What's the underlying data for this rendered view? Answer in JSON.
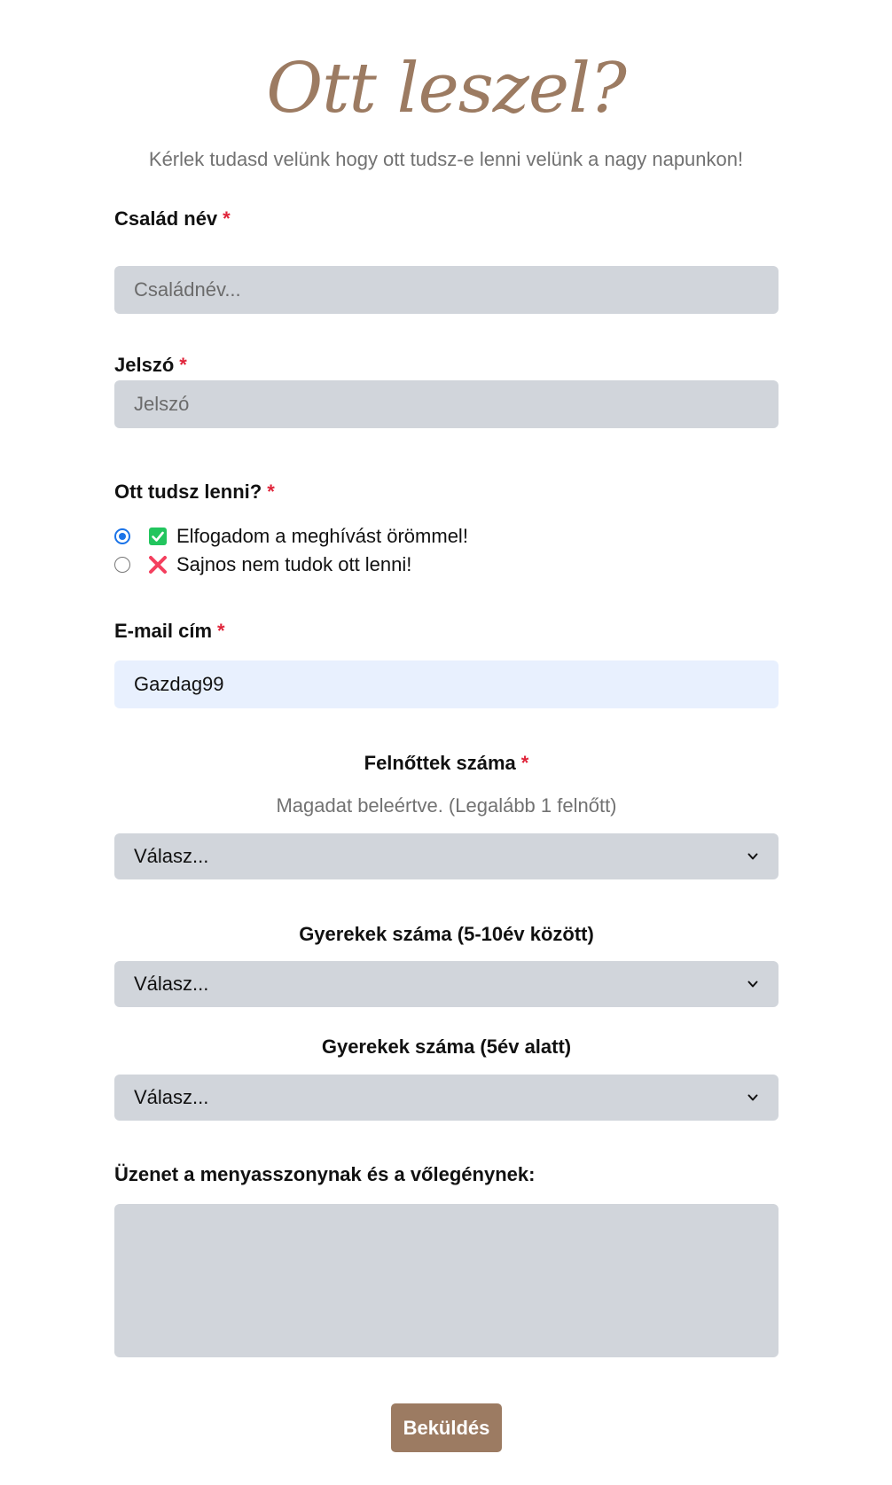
{
  "header": {
    "title": "Ott leszel?",
    "subtitle": "Kérlek tudasd velünk hogy ott tudsz-e lenni velünk a nagy napunkon!"
  },
  "form": {
    "family_name": {
      "label": "Család név",
      "required_mark": "*",
      "placeholder": "Családnév..."
    },
    "password": {
      "label": "Jelszó",
      "required_mark": "*",
      "placeholder": "Jelszó"
    },
    "attendance": {
      "label": "Ott tudsz lenni?",
      "required_mark": "*",
      "options": [
        {
          "label": "Elfogadom a meghívást örömmel!",
          "icon": "green-check-icon",
          "selected": true
        },
        {
          "label": "Sajnos nem tudok ott lenni!",
          "icon": "red-cross-icon",
          "selected": false
        }
      ]
    },
    "email": {
      "label": "E-mail cím",
      "required_mark": "*",
      "value": "Gazdag99"
    },
    "adults": {
      "label": "Felnőttek száma",
      "required_mark": "*",
      "hint": "Magadat beleértve. (Legalább 1 felnőtt)",
      "selected": "Válasz..."
    },
    "children_5_10": {
      "label": "Gyerekek száma (5-10év között)",
      "selected": "Válasz..."
    },
    "children_under_5": {
      "label": "Gyerekek száma (5év alatt)",
      "selected": "Válasz..."
    },
    "message": {
      "label": "Üzenet a menyasszonynak és a vőlegénynek:"
    },
    "submit_label": "Beküldés"
  },
  "colors": {
    "accent": "#9c7b62",
    "required": "#e0243a",
    "field_bg": "#d1d5db",
    "autofill_bg": "#e8f0fe",
    "check_green": "#22c55e",
    "cross_red": "#f43f5e"
  }
}
